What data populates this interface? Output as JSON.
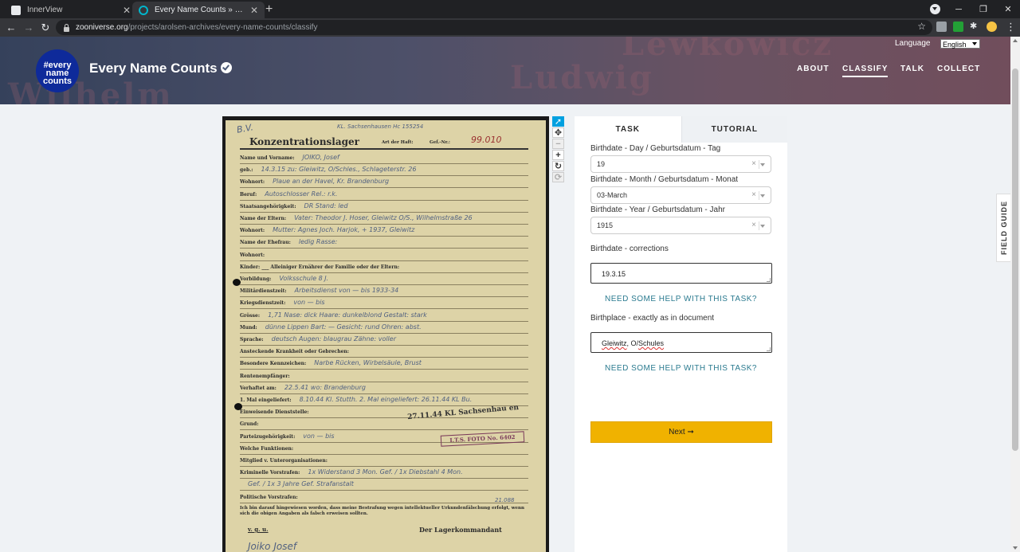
{
  "browser": {
    "tabs": [
      {
        "title": "InnerView",
        "active": false
      },
      {
        "title": "Every Name Counts » Classify — Zooniverse",
        "active": true
      }
    ],
    "url_host": "zooniverse.org",
    "url_path": "/projects/arolsen-archives/every-name-counts/classify",
    "icons": [
      "back-icon",
      "forward-icon",
      "reload-icon",
      "lock-icon",
      "star-icon",
      "extensions-icon",
      "profile-icon",
      "kebab-menu-icon"
    ]
  },
  "header": {
    "language_label": "Language",
    "language_value": "English",
    "logo_lines": [
      "#every",
      "name",
      "counts"
    ],
    "project_title": "Every Name Counts",
    "nav": [
      "ABOUT",
      "CLASSIFY",
      "TALK",
      "COLLECT"
    ],
    "active_nav": "CLASSIFY",
    "background_words": [
      "Lewkowicz",
      "Ludwig",
      "Wilhelm"
    ]
  },
  "document": {
    "heading": "Konzentrationslager",
    "heading_hw": "KL. Sachsenhausen Hc 155254",
    "art_der_haft_label": "Art der Haft:",
    "gef_nr_label": "Gef.-Nr.:",
    "gef_nr_value": "99.010",
    "corner_hw": "B.V.",
    "rows": [
      {
        "label": "Name und Vorname:",
        "value": "JOIKO, Josef"
      },
      {
        "label": "geb.:",
        "value": "14.3.15 zu: Gleiwitz, O/Schles., Schlageterstr. 26"
      },
      {
        "label": "Wohnort:",
        "value": "Plaue an der Havel, Kr. Brandenburg"
      },
      {
        "label": "Beruf:",
        "value": "Autoschlosser  Rel.: r.k."
      },
      {
        "label": "Staatsangehörigkeit:",
        "value": "DR  Stand: led"
      },
      {
        "label": "Name der Eltern:",
        "value": "Vater: Theodor J. Hoser, Gleiwitz O/S., Wilhelmstraße 26"
      },
      {
        "label": "Wohnort:",
        "value": "Mutter: Agnes Joch. Harjok, + 1937, Gleiwitz"
      },
      {
        "label": "Name der Ehefrau:",
        "value": "ledig  Rasse:"
      },
      {
        "label": "Wohnort:",
        "value": ""
      },
      {
        "label": "Kinder: ___ Alleiniger Ernährer der Familie oder der Eltern:",
        "value": ""
      },
      {
        "label": "Vorbildung:",
        "value": "Volksschule 8 J."
      },
      {
        "label": "Militärdienstzeit:",
        "value": "Arbeitsdienst  von — bis 1933-34"
      },
      {
        "label": "Kriegsdienstzeit:",
        "value": "von — bis"
      },
      {
        "label": "Grösse:",
        "value": "1,71  Nase: dick  Haare: dunkelblond  Gestalt: stark"
      },
      {
        "label": "Mund:",
        "value": "dünne Lippen  Bart: —  Gesicht: rund  Ohren: abst."
      },
      {
        "label": "Sprache:",
        "value": "deutsch  Augen: blaugrau  Zähne: voller"
      },
      {
        "label": "Ansteckende Krankheit oder Gebrechen:",
        "value": ""
      },
      {
        "label": "Besondere Kennzeichen:",
        "value": "Narbe Rücken, Wirbelsäule, Brust"
      },
      {
        "label": "Rentenempfänger:",
        "value": ""
      },
      {
        "label": "Verhaftet am:",
        "value": "22.5.41  wo: Brandenburg"
      },
      {
        "label": "1. Mal eingeliefert:",
        "value": "8.10.44 Kl. Stutth.  2. Mal eingeliefert: 26.11.44 KL Bu."
      },
      {
        "label": "Einweisende Dienststelle:",
        "value": ""
      },
      {
        "label": "Grund:",
        "value": ""
      },
      {
        "label": "Parteizugehörigkeit:",
        "value": "von — bis"
      },
      {
        "label": "Welche Funktionen:",
        "value": ""
      },
      {
        "label": "Mitglied v. Unterorganisationen:",
        "value": ""
      },
      {
        "label": "Kriminelle Vorstrafen:",
        "value": "1x Widerstand 3 Mon. Gef. / 1x Diebstahl 4 Mon."
      },
      {
        "label": "",
        "value": "Gef. / 1x 3 Jahre Gef. Strafanstalt"
      },
      {
        "label": "Politische Vorstrafen:",
        "value": ""
      }
    ],
    "date_stamp": "27.11.44 KL Sachsenhau en",
    "its_stamp": "I.T.S. FOTO No. 6402",
    "footer_text": "Ich bin darauf hingewiesen worden, dass meine Bestrafung wegen intellektueller Urkundenfälschung erfolgt, wenn sich die obigen Angaben als falsch erweisen sollten.",
    "vgu": "v. g. u.",
    "commander": "Der Lagerkommandant",
    "signature": "Joiko Josef",
    "ref_hw": "21.088"
  },
  "viewer_tools": [
    "pointer-icon",
    "pan-icon",
    "zoom-out-icon",
    "zoom-in-icon",
    "reset-icon",
    "rotate-icon"
  ],
  "task": {
    "tabs": [
      "TASK",
      "TUTORIAL"
    ],
    "day_label": "Birthdate - Day / Geburtsdatum - Tag",
    "day_value": "19",
    "month_label": "Birthdate - Month / Geburtsdatum - Monat",
    "month_value": "03-March",
    "year_label": "Birthdate - Year / Geburtsdatum - Jahr",
    "year_value": "1915",
    "corrections_label": "Birthdate - corrections",
    "corrections_value": "19.3.15",
    "help1": "NEED SOME HELP WITH THIS TASK?",
    "birthplace_label": "Birthplace - exactly as in document",
    "birthplace_part1": "Gleiwitz",
    "birthplace_part2": ", O/",
    "birthplace_part3": "Schules",
    "help2": "NEED SOME HELP WITH THIS TASK?",
    "next_label": "Next ➞",
    "clear_glyph": "×"
  },
  "field_guide": "FIELD GUIDE"
}
